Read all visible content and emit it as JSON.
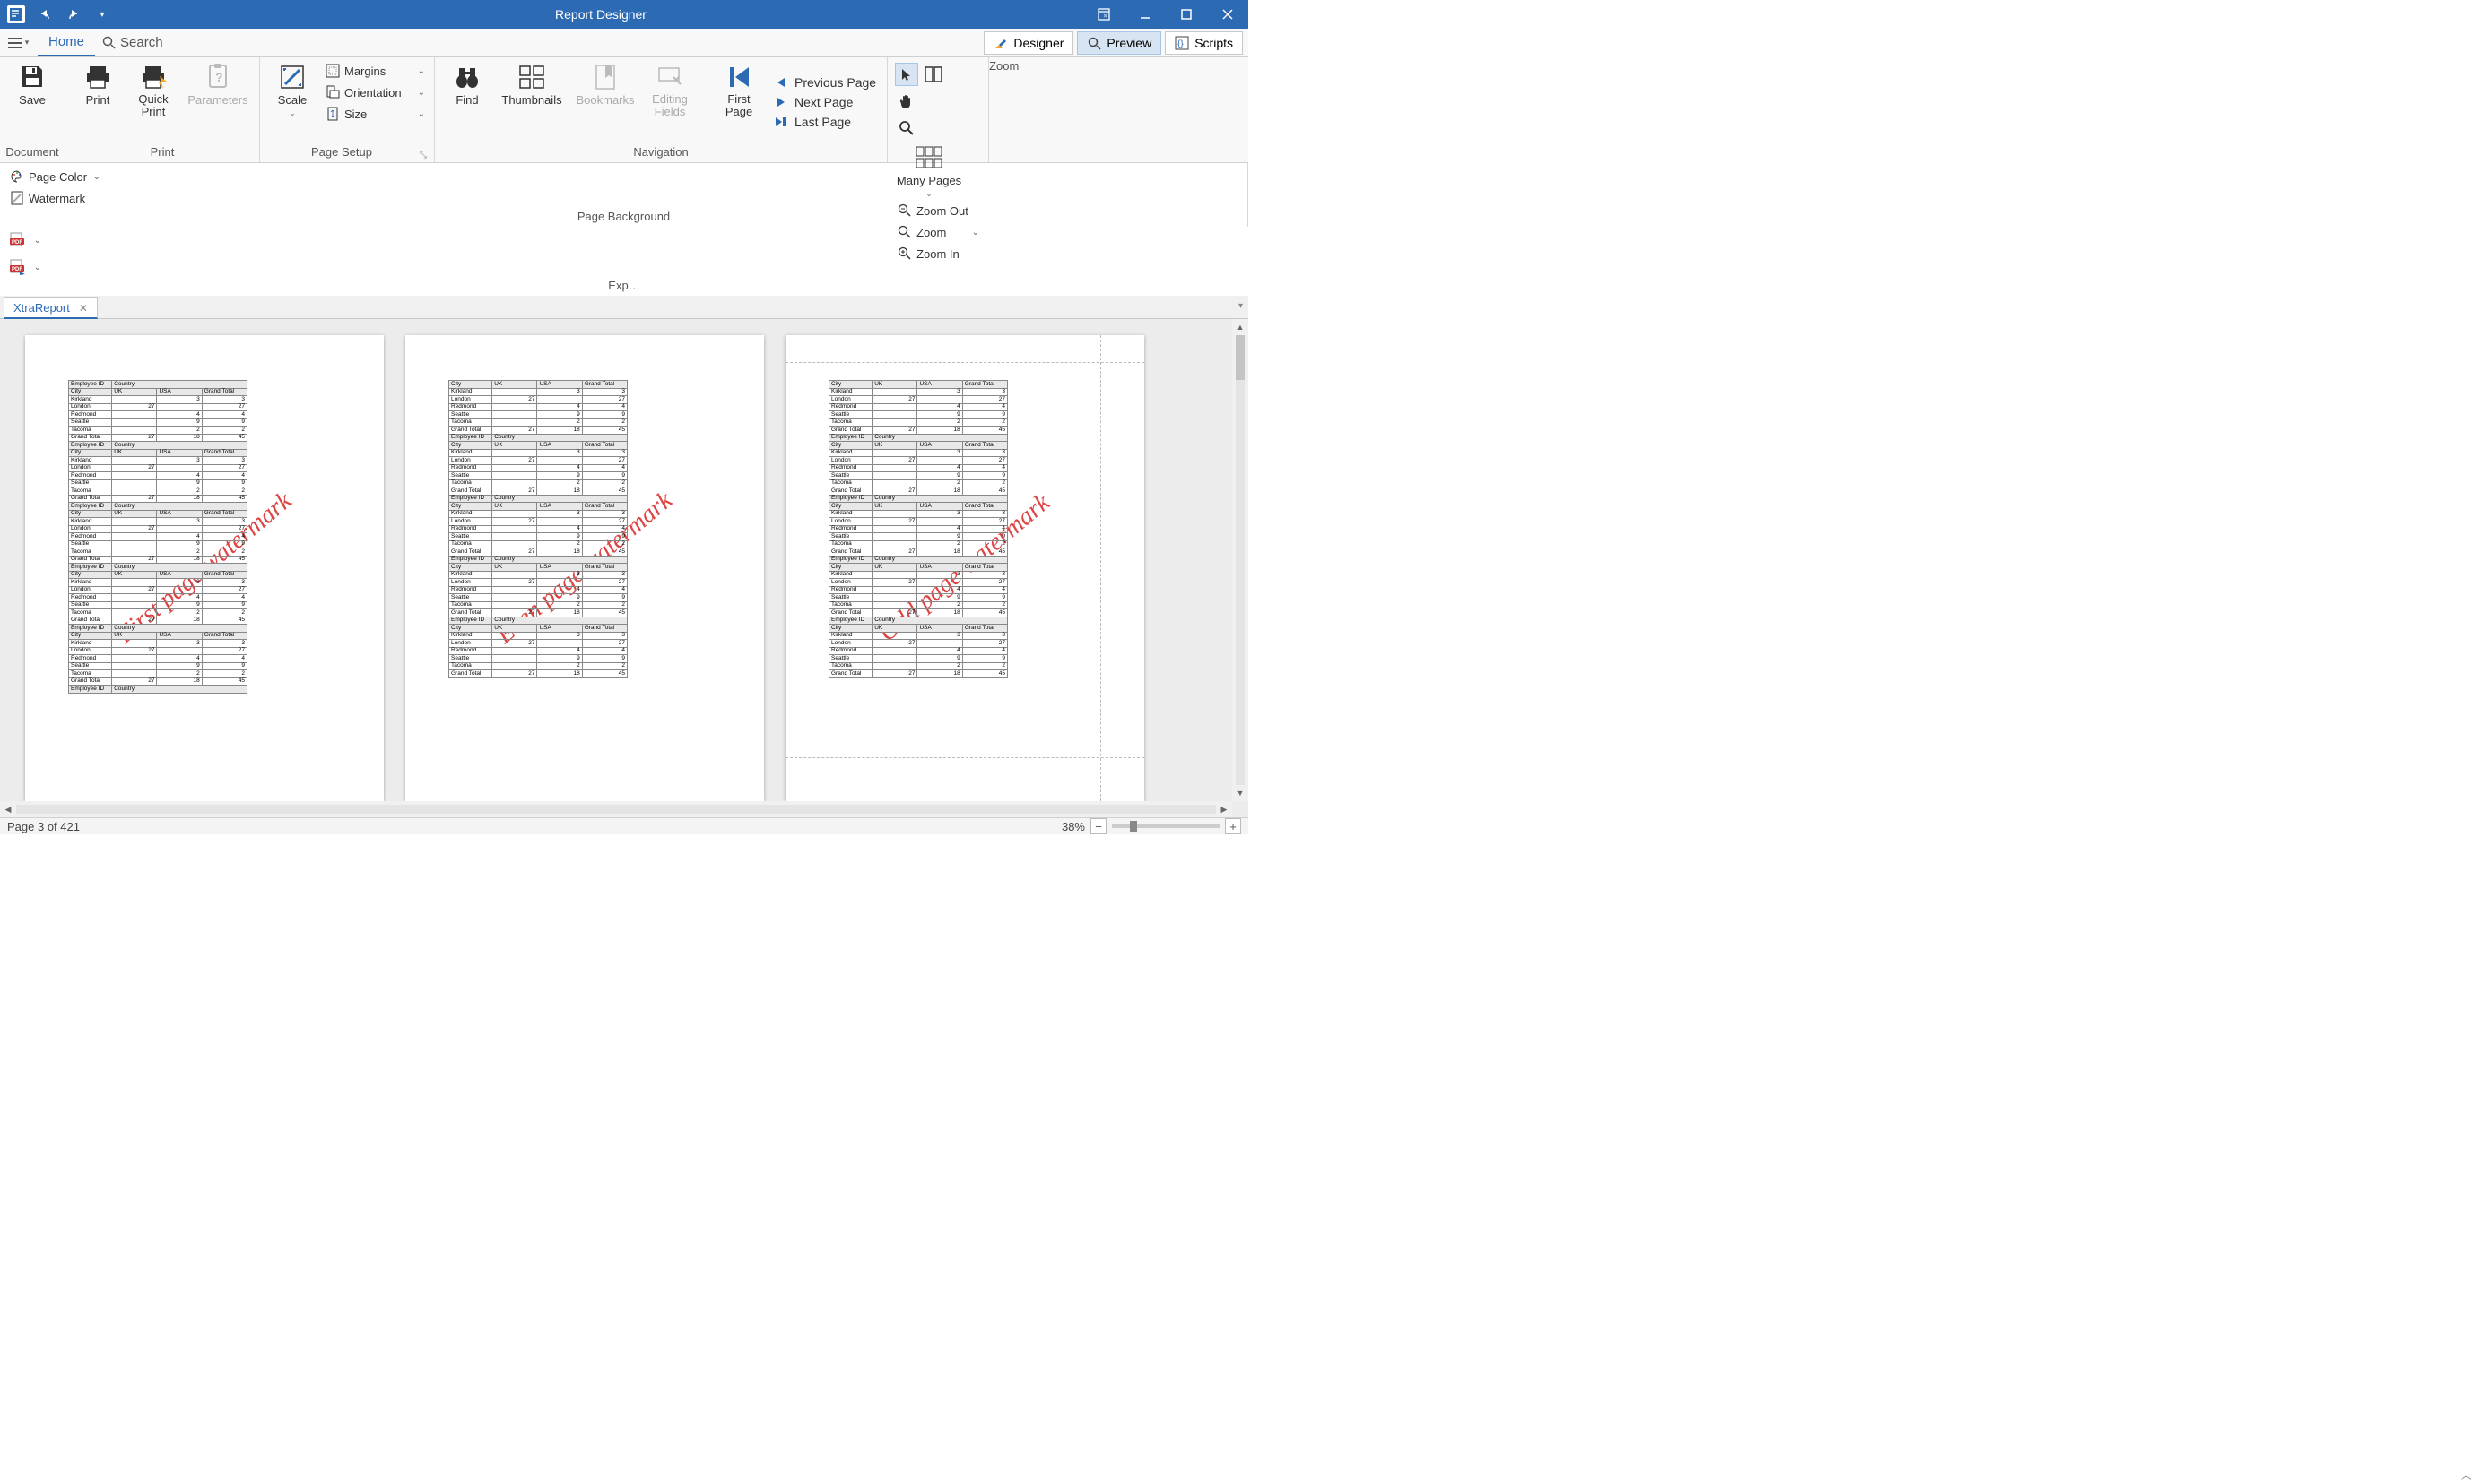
{
  "window": {
    "title": "Report Designer"
  },
  "tabs": {
    "home": "Home",
    "search": "Search",
    "views": {
      "designer": "Designer",
      "preview": "Preview",
      "scripts": "Scripts"
    }
  },
  "ribbon": {
    "groups": {
      "document": "Document",
      "print": "Print",
      "page_setup": "Page Setup",
      "navigation": "Navigation",
      "zoom": "Zoom",
      "page_background": "Page Background",
      "export": "Exp…"
    },
    "buttons": {
      "save": "Save",
      "print": "Print",
      "quick_print": "Quick Print",
      "parameters": "Parameters",
      "scale": "Scale",
      "margins": "Margins",
      "orientation": "Orientation",
      "size": "Size",
      "find": "Find",
      "thumbnails": "Thumbnails",
      "bookmarks": "Bookmarks",
      "editing_fields": "Editing Fields",
      "first_page": "First Page",
      "previous_page": "Previous Page",
      "next_page": "Next  Page",
      "last_page": "Last  Page",
      "many_pages": "Many Pages",
      "zoom_out": "Zoom Out",
      "zoom": "Zoom",
      "zoom_in": "Zoom In",
      "page_color": "Page Color",
      "watermark": "Watermark"
    }
  },
  "document_tab": "XtraReport",
  "status": {
    "page_info": "Page 3 of 421",
    "zoom": "38%"
  },
  "report": {
    "header_employee": "Employee ID",
    "header_country": "Country",
    "header_city": "City",
    "col_uk": "UK",
    "col_usa": "USA",
    "col_grand_total": "Grand Total",
    "rows": [
      {
        "label": "Kirkland",
        "uk": "",
        "usa": "3",
        "gt": "3"
      },
      {
        "label": "London",
        "uk": "27",
        "usa": "",
        "gt": "27"
      },
      {
        "label": "Redmond",
        "uk": "",
        "usa": "4",
        "gt": "4"
      },
      {
        "label": "Seattle",
        "uk": "",
        "usa": "9",
        "gt": "9"
      },
      {
        "label": "Tacoma",
        "uk": "",
        "usa": "2",
        "gt": "2"
      },
      {
        "label": "Grand Total",
        "uk": "27",
        "usa": "18",
        "gt": "45"
      }
    ]
  },
  "watermarks": {
    "first": "First page watermark",
    "even": "Even page watermark",
    "odd": "Odd page watermark"
  }
}
